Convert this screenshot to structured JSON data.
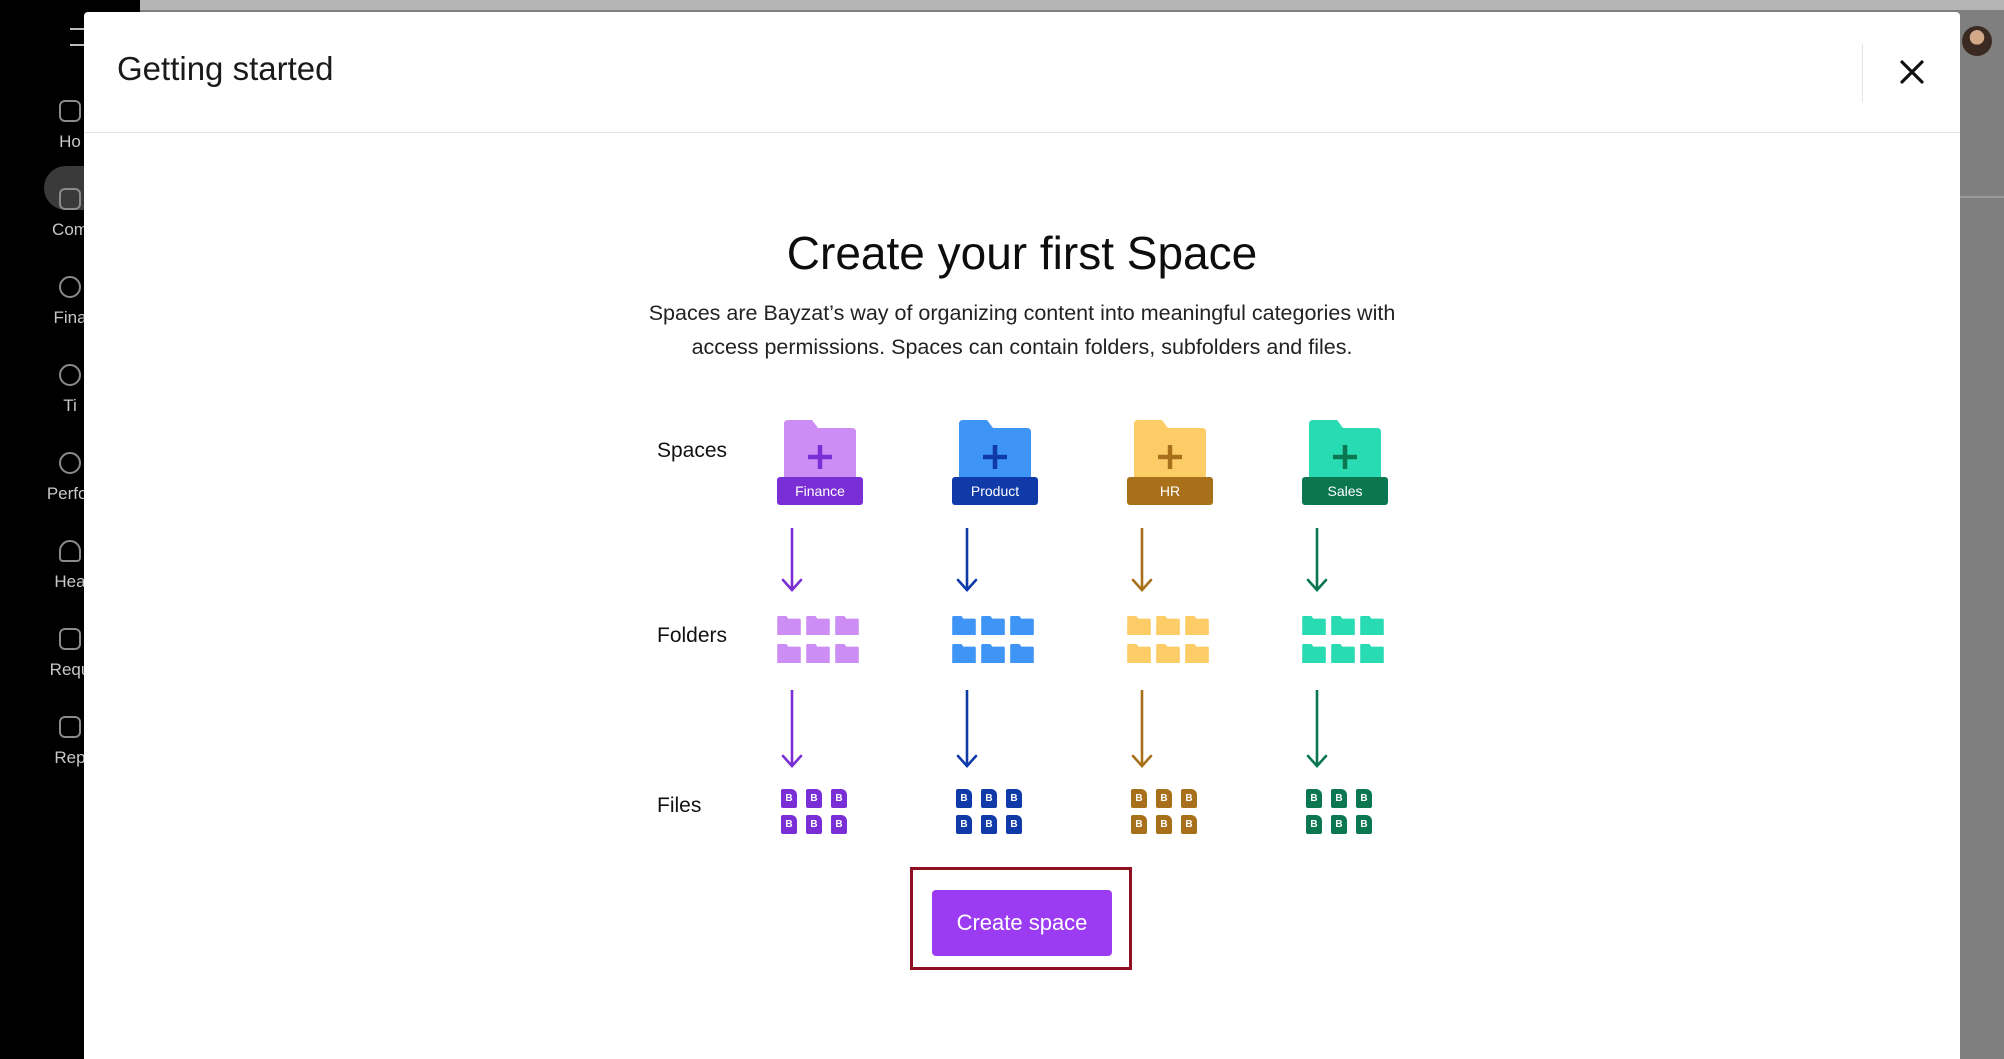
{
  "background": {
    "sidebar": {
      "items": [
        {
          "label": "Ho"
        },
        {
          "label": "Com"
        },
        {
          "label": "Fina"
        },
        {
          "label": "Ti"
        },
        {
          "label": "Perfor"
        },
        {
          "label": "Hea"
        },
        {
          "label": "Requ"
        },
        {
          "label": "Rep"
        }
      ]
    }
  },
  "modal": {
    "title": "Getting started",
    "heading": "Create your first Space",
    "description": "Spaces are Bayzat’s way of organizing content into meaningful categories with access permissions. Spaces can contain folders, subfolders and files.",
    "diagram": {
      "row_labels": {
        "spaces": "Spaces",
        "folders": "Folders",
        "files": "Files"
      },
      "spaces": [
        {
          "name": "Finance",
          "light": "#cc8ef4",
          "dark": "#7a2fd6",
          "plus": "#7a2fd6"
        },
        {
          "name": "Product",
          "light": "#3f95f5",
          "dark": "#0f3aa8",
          "plus": "#0f3aa8"
        },
        {
          "name": "HR",
          "light": "#fccc67",
          "dark": "#a8701a",
          "plus": "#a8701a"
        },
        {
          "name": "Sales",
          "light": "#28dbb2",
          "dark": "#0a7750",
          "plus": "#0a7750"
        }
      ],
      "file_glyph": "B"
    },
    "create_button": "Create space"
  },
  "icons": {
    "close": "close-icon",
    "plus": "plus-icon",
    "arrow": "arrow-down-icon",
    "folder": "folder-icon",
    "file": "file-icon"
  },
  "colors": {
    "accent": "#9b3cf3",
    "highlight_border": "#8e1020"
  }
}
